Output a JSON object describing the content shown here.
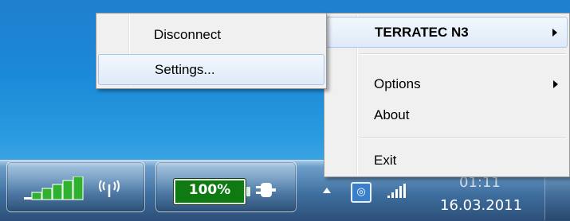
{
  "main_menu": {
    "items": [
      {
        "label": "TERRATEC N3",
        "bold": true,
        "submenu": true,
        "highlighted": true
      },
      {
        "label": "Options",
        "submenu": true
      },
      {
        "label": "About"
      },
      {
        "label": "Exit"
      }
    ]
  },
  "sub_menu": {
    "items": [
      {
        "label": "Disconnect"
      },
      {
        "label": "Settings...",
        "highlighted": true
      }
    ]
  },
  "taskbar": {
    "battery_percent_label": "100%",
    "clock_time": "01:11",
    "clock_date": "16.03.2011"
  },
  "colors": {
    "menu_background": "#f0f0f0",
    "menu_highlight_border": "#a8c7ec",
    "battery_green": "#0f7a12",
    "desktop_blue": "#1b8ad8"
  },
  "icons": {
    "signal": "signal-strength-icon",
    "antenna": "antenna-icon",
    "battery": "battery-icon",
    "plug": "power-plug-icon",
    "show_hidden": "chevron-up-icon",
    "tray_app": "terratec-tray-icon",
    "network": "network-signal-icon"
  }
}
